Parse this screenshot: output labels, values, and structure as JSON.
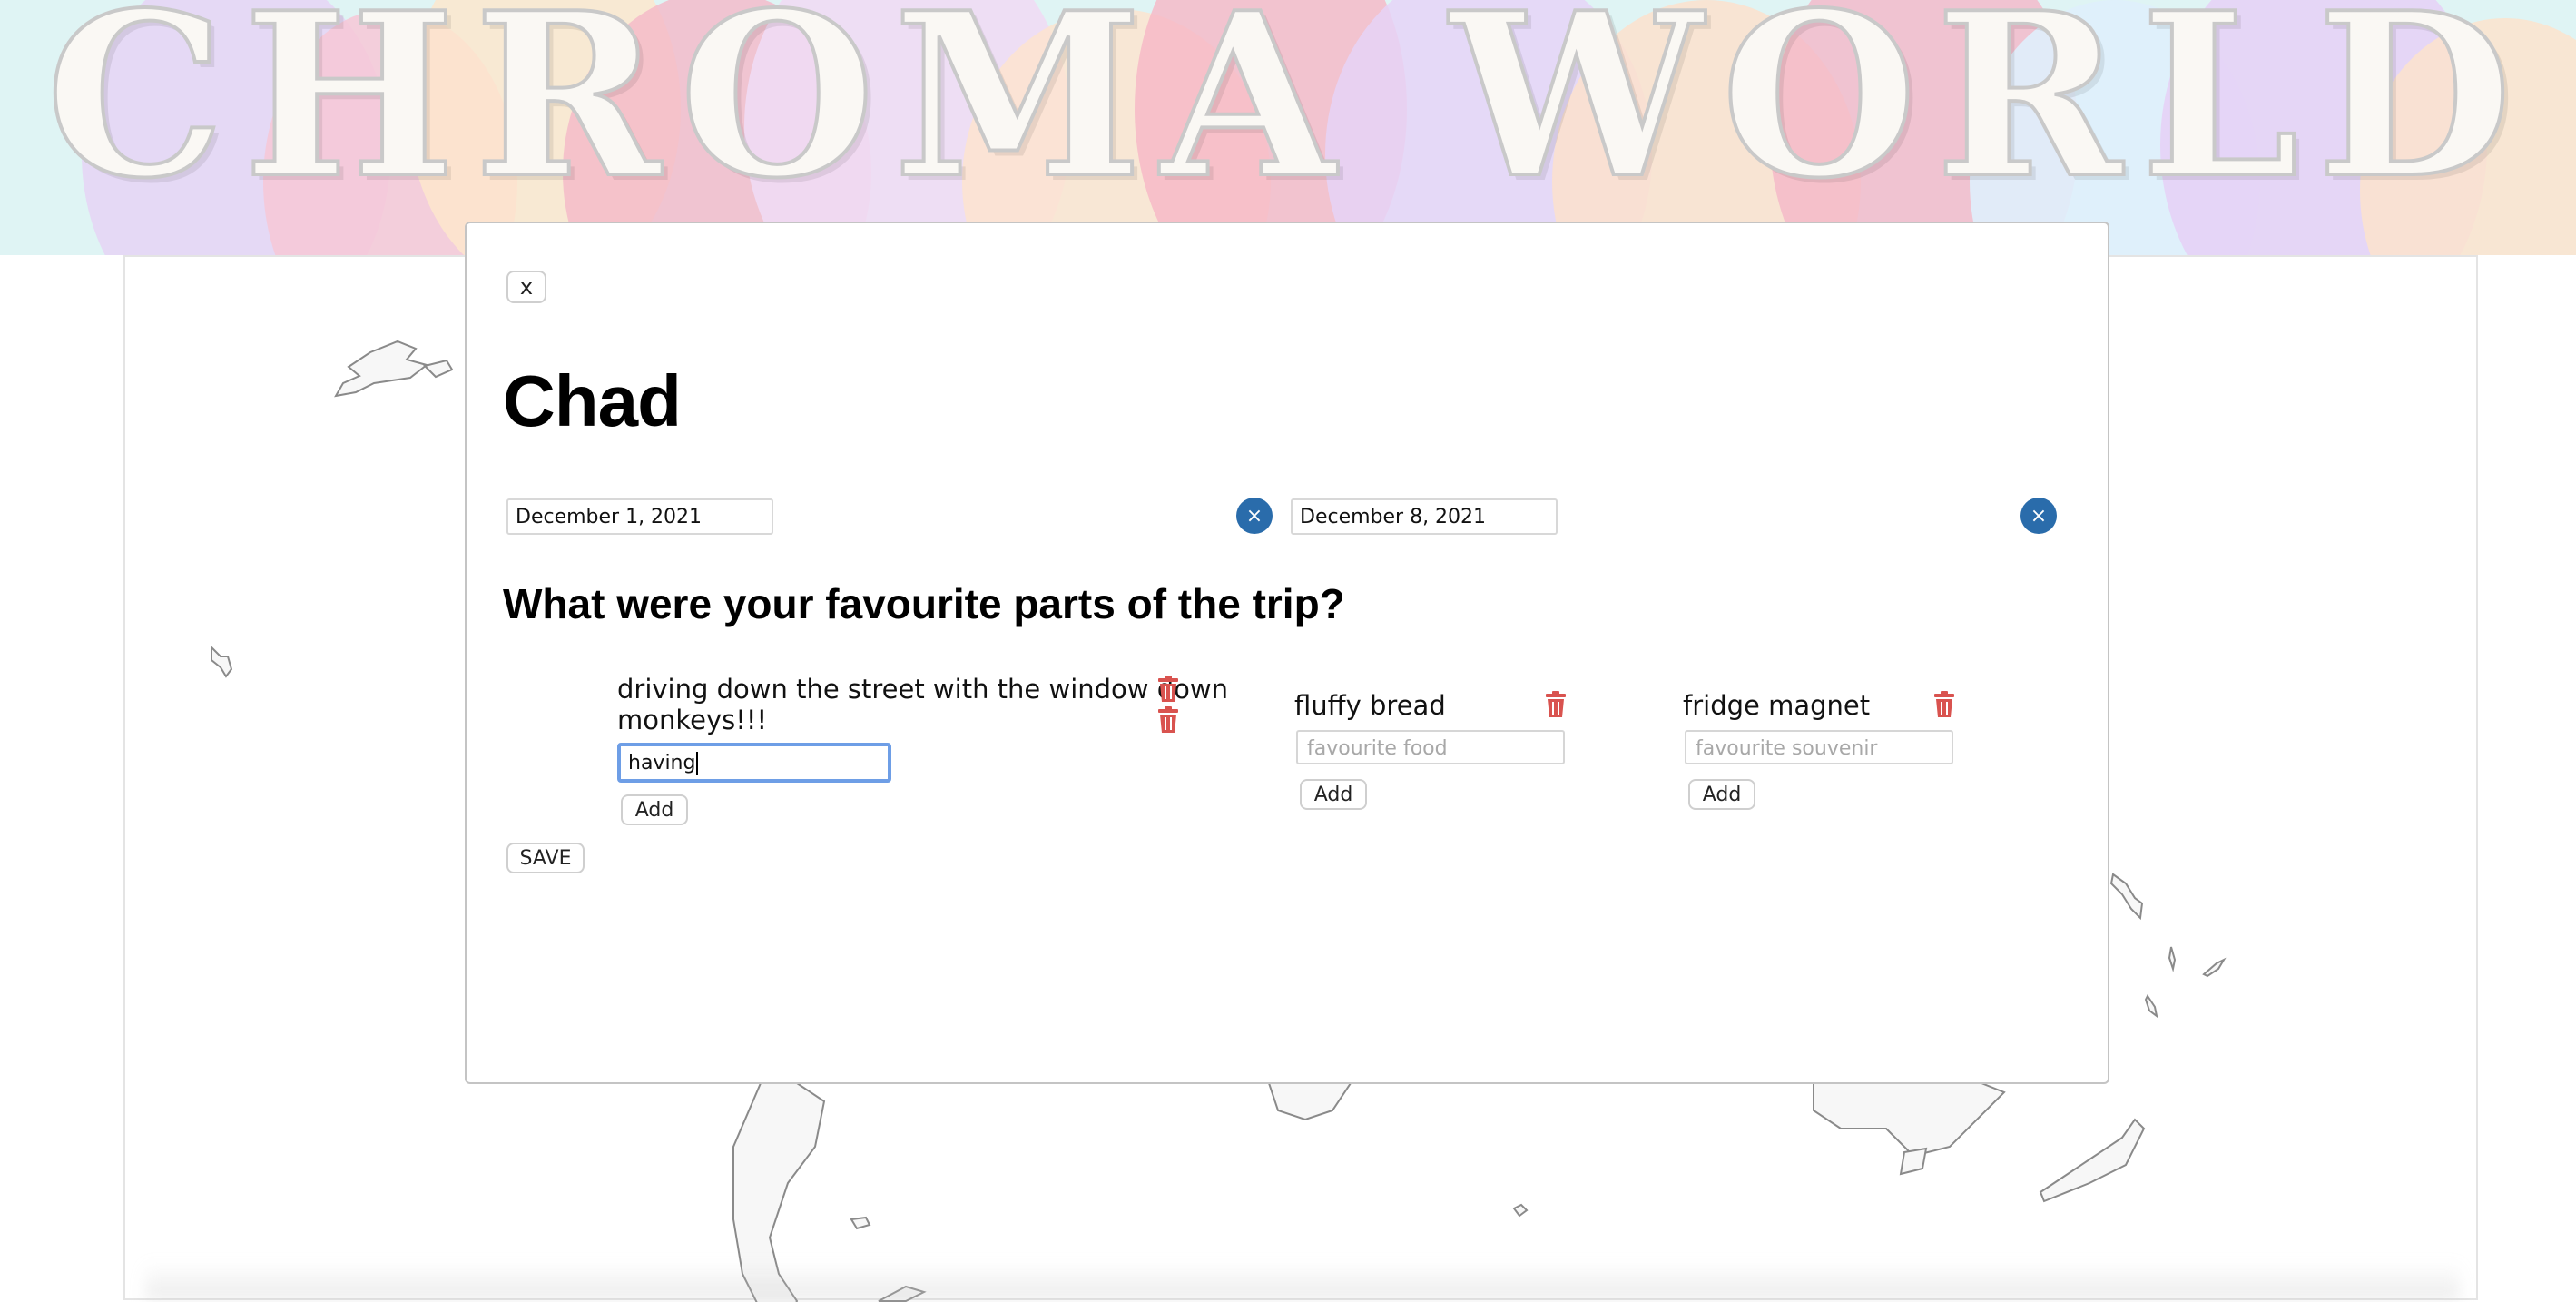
{
  "app": {
    "title": "CHROMA WORLD"
  },
  "modal": {
    "close_label": "x",
    "country": "Chad",
    "start_date": "December 1, 2021",
    "end_date": "December 8, 2021",
    "clear_label": "×",
    "question": "What were your favourite parts of the trip?",
    "save_label": "SAVE",
    "columns": [
      {
        "items": [
          "driving down the street with the window down",
          "monkeys!!!"
        ],
        "input_value": "having",
        "input_placeholder": "",
        "add_label": "Add"
      },
      {
        "items": [
          "fluffy bread"
        ],
        "input_value": "",
        "input_placeholder": "favourite food",
        "add_label": "Add"
      },
      {
        "items": [
          "fridge magnet"
        ],
        "input_value": "",
        "input_placeholder": "favourite souvenir",
        "add_label": "Add"
      }
    ]
  },
  "colors": {
    "clear_button": "#2a6cab",
    "trash_icon": "#d9534f",
    "focus_ring": "#6e9ee6"
  },
  "icons": {
    "delete": "trash-icon",
    "clear": "close-circle-icon"
  }
}
